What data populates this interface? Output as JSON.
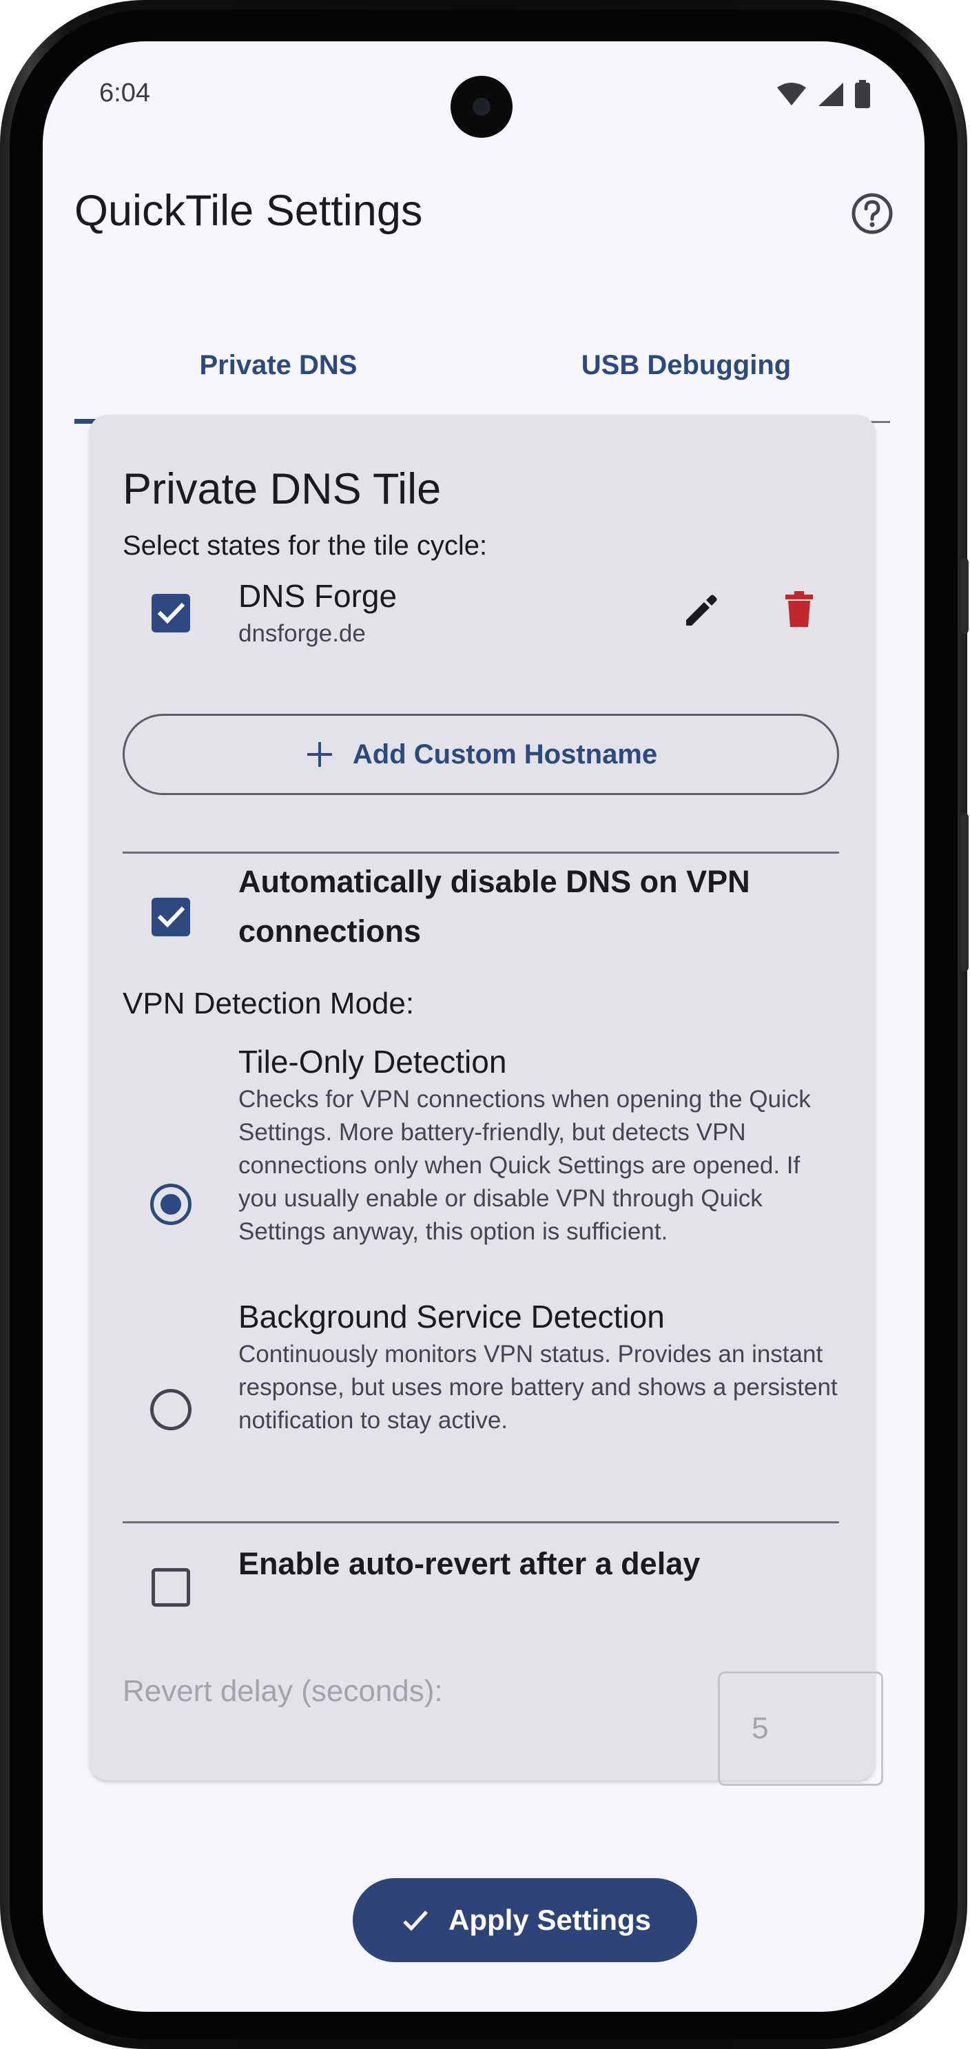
{
  "status_bar": {
    "time": "6:04",
    "icons": [
      "wifi-icon",
      "cell-signal-icon",
      "battery-icon"
    ]
  },
  "app_bar": {
    "title": "QuickTile Settings",
    "help_icon": "help-circle-icon"
  },
  "tabs": [
    {
      "label": "Private DNS",
      "active": true
    },
    {
      "label": "USB Debugging",
      "active": false
    }
  ],
  "card": {
    "title": "Private DNS Tile",
    "subtitle": "Select states for the tile cycle:",
    "entries": [
      {
        "name": "DNS Forge",
        "hostname": "dnsforge.de",
        "checked": true,
        "edit_icon": "pencil-icon",
        "delete_icon": "trash-icon"
      }
    ],
    "add_button_label": "Add Custom Hostname",
    "vpn_disable": {
      "label": "Automatically disable DNS on VPN connections",
      "checked": true
    },
    "detection_mode": {
      "heading": "VPN Detection Mode:",
      "options": [
        {
          "title": "Tile-Only Detection",
          "description": "Checks for VPN connections when opening the Quick Settings. More battery-friendly, but detects VPN connections only when Quick Settings are opened. If you usually enable or disable VPN through Quick Settings anyway, this option is sufficient.",
          "selected": true
        },
        {
          "title": "Background Service Detection",
          "description": "Continuously monitors VPN status. Provides an instant response, but uses more battery and shows a persistent notification to stay active.",
          "selected": false
        }
      ]
    },
    "auto_revert": {
      "label": "Enable auto-revert after a delay",
      "checked": false,
      "delay_label": "Revert delay (seconds):",
      "delay_value": "5"
    }
  },
  "apply_button_label": "Apply Settings",
  "colors": {
    "primary": "#2d4a80",
    "delete": "#c1272d",
    "card_bg": "#e2e2e8",
    "screen_bg": "#f7f6fc"
  }
}
